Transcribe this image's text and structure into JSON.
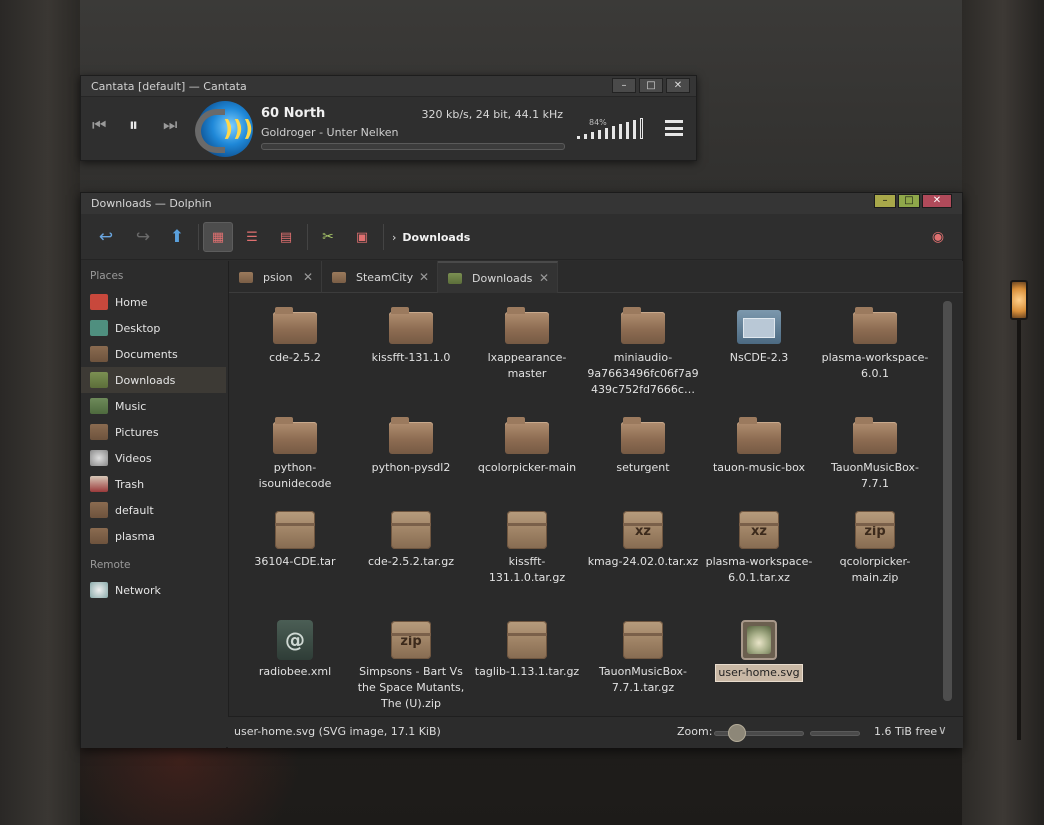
{
  "cantata": {
    "window_title": "Cantata [default] — Cantata",
    "song": "60 North",
    "artist_album": "Goldroger - Unter Nelken",
    "tech_info": "320 kb/s, 24 bit, 44.1 kHz",
    "volume": "84%",
    "volume_fraction": 0.84,
    "progress_fraction": 0.0,
    "controls": {
      "prev": "⏮",
      "pause": "⏸",
      "next": "⏭"
    },
    "win_min": "–",
    "win_max": "□",
    "win_close": "✕"
  },
  "dolphin": {
    "window_title": "Downloads — Dolphin",
    "win_min": "–",
    "win_max": "□",
    "win_close": "✕",
    "colors": {
      "min": "#a8a84a",
      "max": "#8fa84a",
      "close": "#b04a5a",
      "selection": "#c9b8a5"
    },
    "breadcrumb": {
      "chevron": "›",
      "current": "Downloads"
    },
    "sidebar": {
      "places_heading": "Places",
      "places": [
        {
          "label": "Home",
          "icon": "home-icon"
        },
        {
          "label": "Desktop",
          "icon": "desktop-icon"
        },
        {
          "label": "Documents",
          "icon": "documents-folder-icon"
        },
        {
          "label": "Downloads",
          "icon": "downloads-folder-icon",
          "selected": true
        },
        {
          "label": "Music",
          "icon": "music-folder-icon"
        },
        {
          "label": "Pictures",
          "icon": "pictures-folder-icon"
        },
        {
          "label": "Videos",
          "icon": "videos-folder-icon"
        },
        {
          "label": "Trash",
          "icon": "trash-icon"
        },
        {
          "label": "default",
          "icon": "folder-icon"
        },
        {
          "label": "plasma",
          "icon": "folder-icon"
        }
      ],
      "remote_heading": "Remote",
      "remote": [
        {
          "label": "Network",
          "icon": "network-icon"
        }
      ]
    },
    "tabs": [
      {
        "label": "psion",
        "close": "✕"
      },
      {
        "label": "SteamCity",
        "close": "✕"
      },
      {
        "label": "Downloads",
        "close": "✕",
        "selected": true
      }
    ],
    "files": [
      {
        "name": "cde-2.5.2",
        "type": "folder"
      },
      {
        "name": "kissfft-131.1.0",
        "type": "folder"
      },
      {
        "name": "lxappearance-master",
        "type": "folder"
      },
      {
        "name": "miniaudio-9a7663496fc06f7a9439c752fd7666c…",
        "type": "folder"
      },
      {
        "name": "NsCDE-2.3",
        "type": "folder-special"
      },
      {
        "name": "plasma-workspace-6.0.1",
        "type": "folder"
      },
      {
        "name": "python-isounidecode",
        "type": "folder"
      },
      {
        "name": "python-pysdl2",
        "type": "folder"
      },
      {
        "name": "qcolorpicker-main",
        "type": "folder"
      },
      {
        "name": "seturgent",
        "type": "folder"
      },
      {
        "name": "tauon-music-box",
        "type": "folder"
      },
      {
        "name": "TauonMusicBox-7.7.1",
        "type": "folder"
      },
      {
        "name": "36104-CDE.tar",
        "type": "archive"
      },
      {
        "name": "cde-2.5.2.tar.gz",
        "type": "archive"
      },
      {
        "name": "kissfft-131.1.0.tar.gz",
        "type": "archive"
      },
      {
        "name": "kmag-24.02.0.tar.xz",
        "type": "archive-xz",
        "glyph": "xz"
      },
      {
        "name": "plasma-workspace-6.0.1.tar.xz",
        "type": "archive-xz",
        "glyph": "xz"
      },
      {
        "name": "qcolorpicker-main.zip",
        "type": "archive-zip",
        "glyph": "zip"
      },
      {
        "name": "radiobee.xml",
        "type": "xml",
        "glyph": "@"
      },
      {
        "name": "Simpsons - Bart Vs the Space Mutants, The (U).zip",
        "type": "archive-zip",
        "glyph": "zip"
      },
      {
        "name": "taglib-1.13.1.tar.gz",
        "type": "archive"
      },
      {
        "name": "TauonMusicBox-7.7.1.tar.gz",
        "type": "archive"
      },
      {
        "name": "user-home.svg",
        "type": "svg",
        "selected": true
      }
    ],
    "status": {
      "selection_info": "user-home.svg (SVG image, 17.1 KiB)",
      "zoom_label": "Zoom:",
      "free_space": "1.6 TiB free",
      "dropdown": "∨"
    }
  }
}
